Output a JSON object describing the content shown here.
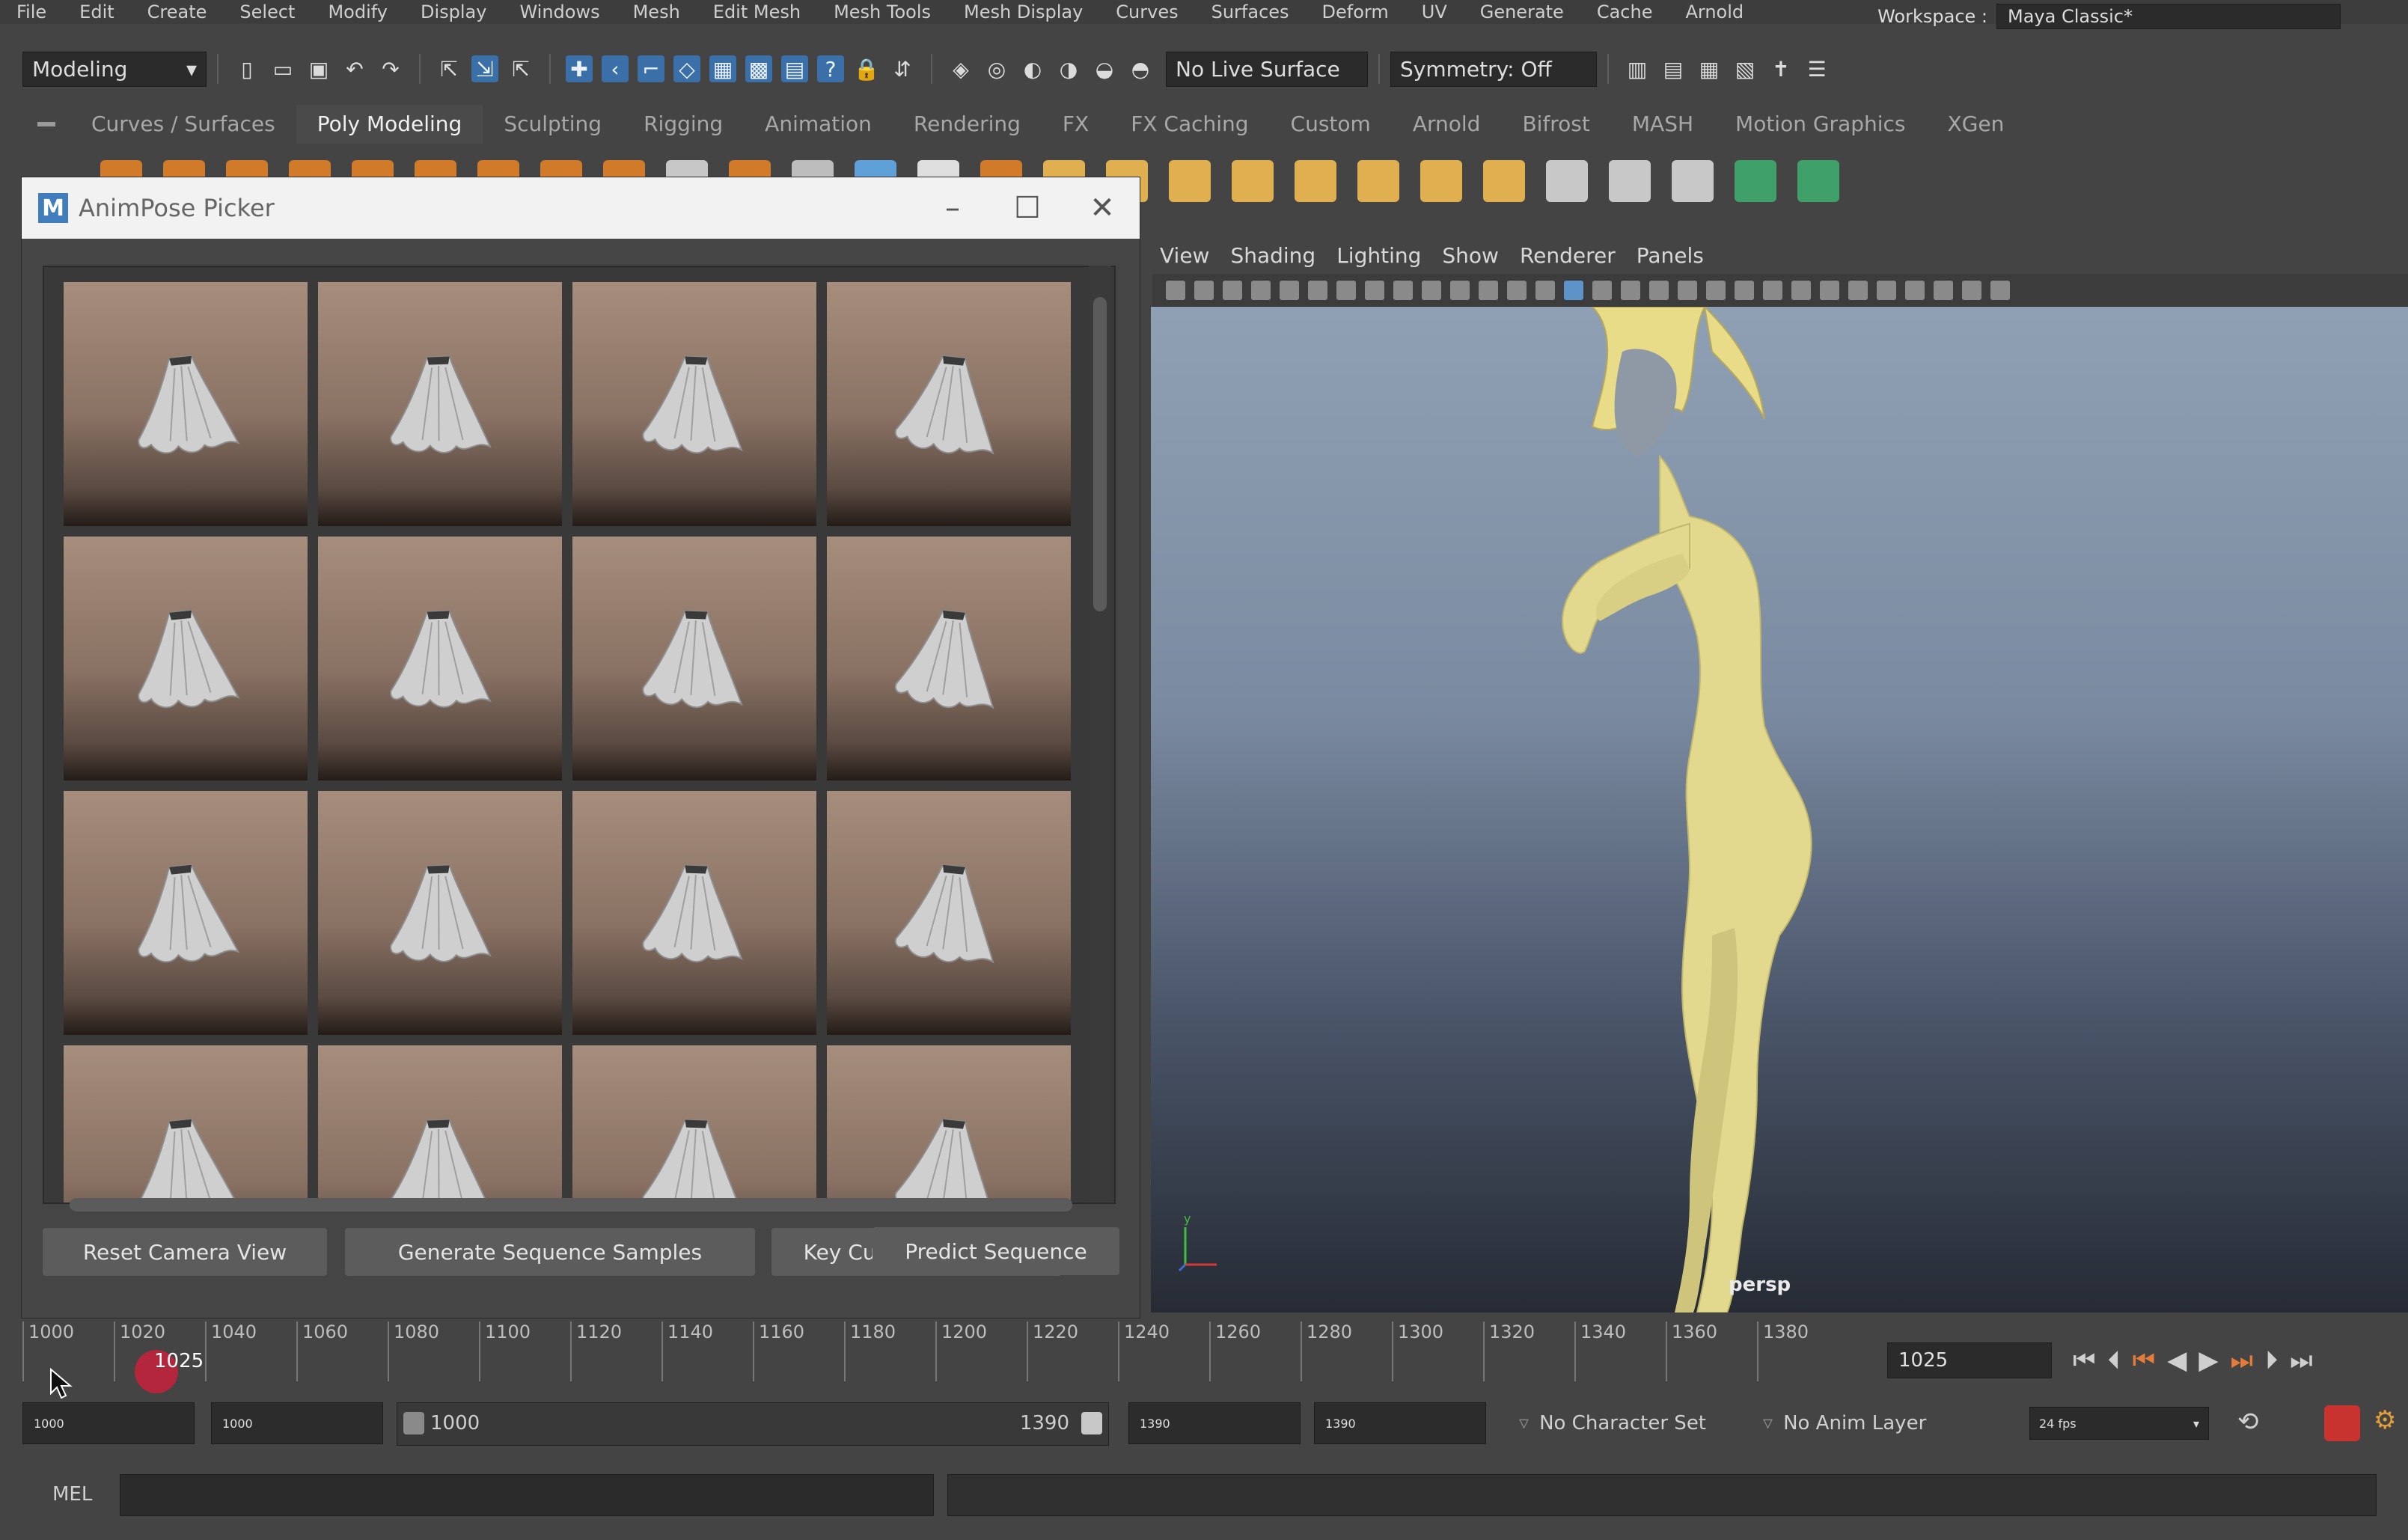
{
  "menubar": {
    "items": [
      "File",
      "Edit",
      "Create",
      "Select",
      "Modify",
      "Display",
      "Windows",
      "Mesh",
      "Edit Mesh",
      "Mesh Tools",
      "Mesh Display",
      "Curves",
      "Surfaces",
      "Deform",
      "UV",
      "Generate",
      "Cache",
      "Arnold"
    ],
    "workspace_label": "Workspace :",
    "workspace_value": "Maya Classic*"
  },
  "statusline": {
    "mode": "Modeling",
    "live_surface": "No Live Surface",
    "symmetry": "Symmetry: Off"
  },
  "shelf_tabs": [
    {
      "label": "Curves / Surfaces",
      "active": false
    },
    {
      "label": "Poly Modeling",
      "active": true
    },
    {
      "label": "Sculpting",
      "active": false
    },
    {
      "label": "Rigging",
      "active": false
    },
    {
      "label": "Animation",
      "active": false
    },
    {
      "label": "Rendering",
      "active": false
    },
    {
      "label": "FX",
      "active": false
    },
    {
      "label": "FX Caching",
      "active": false
    },
    {
      "label": "Custom",
      "active": false
    },
    {
      "label": "Arnold",
      "active": false
    },
    {
      "label": "Bifrost",
      "active": false
    },
    {
      "label": "MASH",
      "active": false
    },
    {
      "label": "Motion Graphics",
      "active": false
    },
    {
      "label": "XGen",
      "active": false
    }
  ],
  "dialog": {
    "app_letter": "M",
    "title": "AnimPose Picker",
    "thumbnail_count": 16,
    "buttons": {
      "reset": "Reset Camera View",
      "generate": "Generate Sequence Samples",
      "key": "Key Current Selection",
      "predict": "Predict Sequence"
    }
  },
  "viewport": {
    "menu": [
      "View",
      "Shading",
      "Lighting",
      "Show",
      "Renderer",
      "Panels"
    ],
    "camera_label": "persp",
    "axis_label": "y",
    "background_top": "#90a0b4",
    "model_color": "#e2d88e"
  },
  "timeline": {
    "ticks": [
      "1000",
      "1020",
      "1040",
      "1060",
      "1080",
      "1100",
      "1120",
      "1140",
      "1160",
      "1180",
      "1200",
      "1220",
      "1240",
      "1260",
      "1280",
      "1300",
      "1320",
      "1340",
      "1360",
      "1380"
    ],
    "current_frame": "1025",
    "current_field": "1025",
    "playback_icons": [
      "go-start-icon",
      "step-back-key-icon",
      "prev-key-icon",
      "play-back-icon",
      "play-forward-icon",
      "next-key-icon",
      "step-forward-icon",
      "go-end-icon"
    ]
  },
  "range": {
    "start": "1000",
    "anim_start": "1000",
    "slider_start": "1000",
    "slider_end": "1390",
    "anim_end": "1390",
    "end": "1390",
    "character_set": "No Character Set",
    "anim_layer": "No Anim Layer",
    "fps": "24 fps"
  },
  "mel": {
    "label": "MEL"
  }
}
